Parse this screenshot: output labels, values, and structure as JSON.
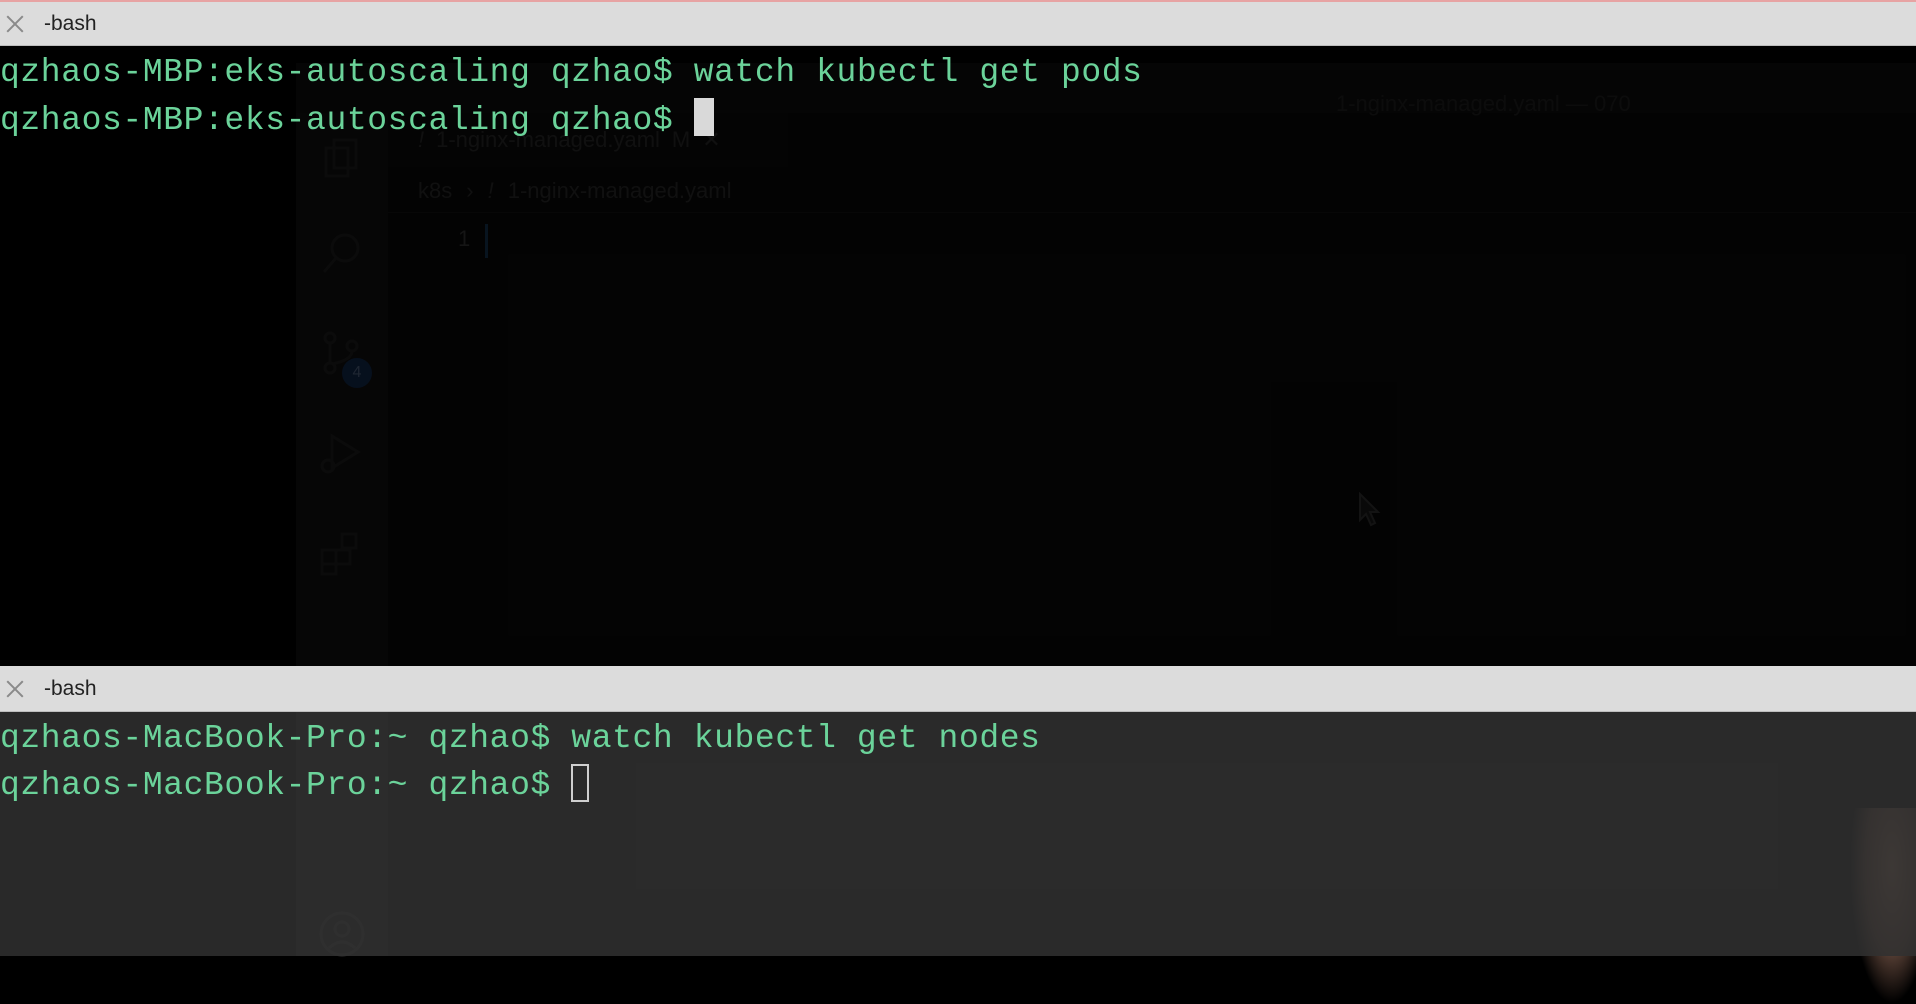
{
  "background_editor": {
    "window_title": "1-nginx-managed.yaml — 070",
    "tab_label": "1-nginx-managed.yaml",
    "tab_modified": "M",
    "breadcrumb_folder": "k8s",
    "breadcrumb_file": "1-nginx-managed.yaml",
    "line_number": "1",
    "scm_badge": "4"
  },
  "terminal_top": {
    "tab_title": "-bash",
    "lines": [
      "qzhaos-MBP:eks-autoscaling qzhao$ watch kubectl get pods",
      "qzhaos-MBP:eks-autoscaling qzhao$ "
    ]
  },
  "terminal_bottom": {
    "tab_title": "-bash",
    "lines": [
      "qzhaos-MacBook-Pro:~ qzhao$ watch kubectl get nodes",
      "qzhaos-MacBook-Pro:~ qzhao$ "
    ]
  },
  "colors": {
    "prompt_text": "#6bd39a",
    "tab_bar": "#dcdcdc"
  }
}
